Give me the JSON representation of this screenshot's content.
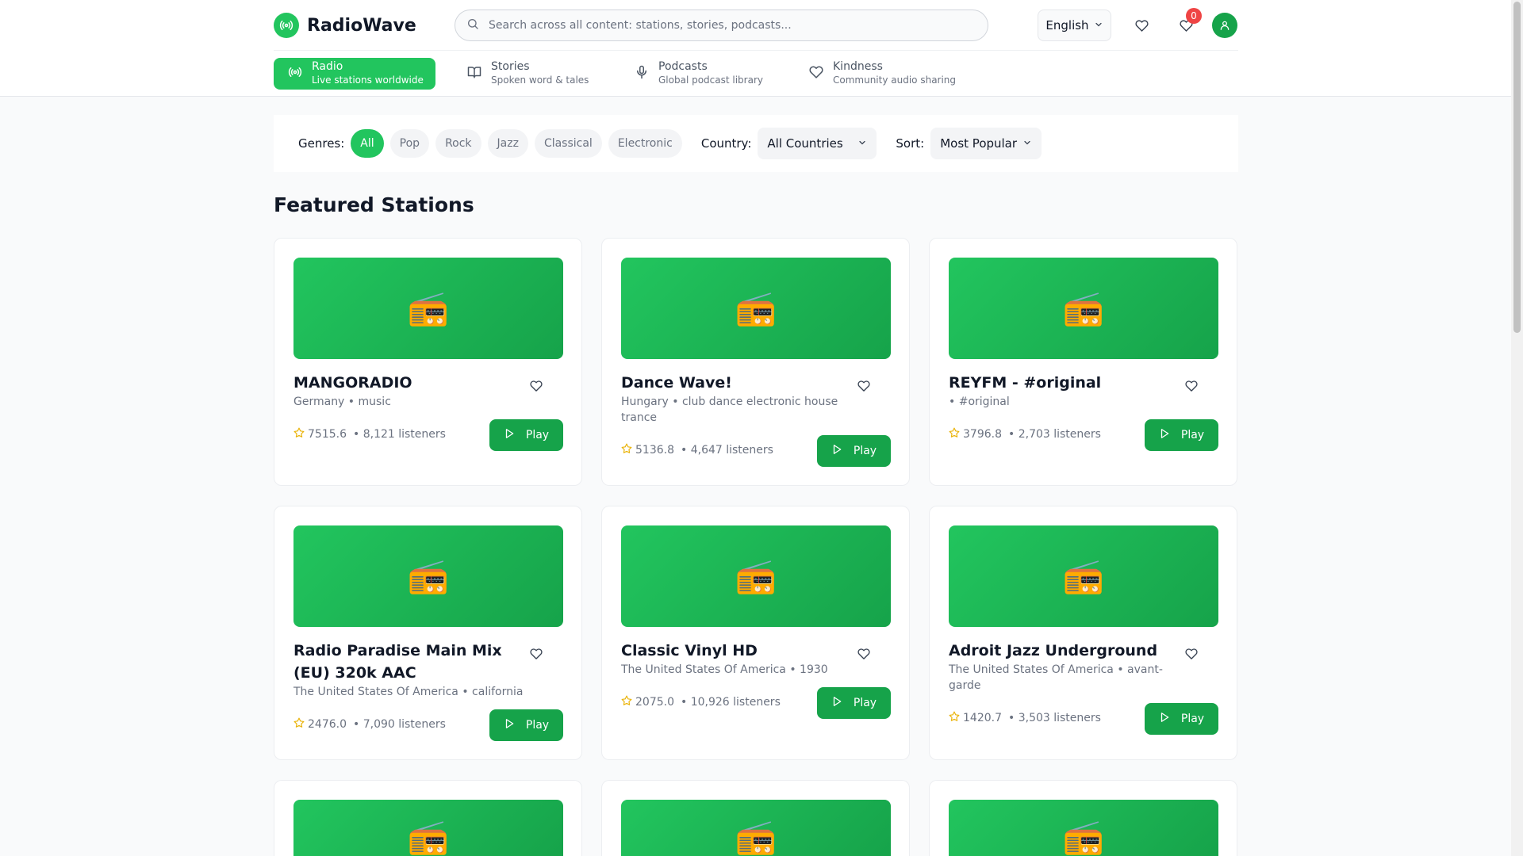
{
  "app": {
    "name": "RadioWave"
  },
  "search": {
    "placeholder": "Search across all content: stations, stories, podcasts..."
  },
  "language": {
    "selected": "English"
  },
  "cart_count": "0",
  "nav": [
    {
      "label": "Radio",
      "sub": "Live stations worldwide",
      "icon": "radio-broadcast-icon"
    },
    {
      "label": "Stories",
      "sub": "Spoken word & tales",
      "icon": "book-icon"
    },
    {
      "label": "Podcasts",
      "sub": "Global podcast library",
      "icon": "microphone-icon"
    },
    {
      "label": "Kindness",
      "sub": "Community audio sharing",
      "icon": "heart-icon"
    }
  ],
  "filters": {
    "genres_label": "Genres:",
    "genres": [
      "All",
      "Pop",
      "Rock",
      "Jazz",
      "Classical",
      "Electronic"
    ],
    "active_genre": "All",
    "country_label": "Country:",
    "country_value": "All Countries",
    "sort_label": "Sort:",
    "sort_value": "Most Popular"
  },
  "section_title": "Featured Stations",
  "play_label": "Play",
  "stations": [
    {
      "name": "MANGORADIO",
      "sub": "Germany • music",
      "score": "7515.6",
      "listeners": "• 8,121 listeners"
    },
    {
      "name": "Dance Wave!",
      "sub": "Hungary • club dance electronic house trance",
      "score": "5136.8",
      "listeners": "• 4,647 listeners"
    },
    {
      "name": "REYFM - #original",
      "sub": "• #original",
      "score": "3796.8",
      "listeners": "• 2,703 listeners"
    },
    {
      "name": "Radio Paradise Main Mix (EU) 320k AAC",
      "sub": "The United States Of America • california",
      "score": "2476.0",
      "listeners": "• 7,090 listeners"
    },
    {
      "name": "Classic Vinyl HD",
      "sub": "The United States Of America • 1930",
      "score": "2075.0",
      "listeners": "• 10,926 listeners"
    },
    {
      "name": "Adroit Jazz Underground",
      "sub": "The United States Of America • avant-garde",
      "score": "1420.7",
      "listeners": "• 3,503 listeners"
    }
  ],
  "colors": {
    "brand": "#22c55e",
    "brand_dark": "#16a34a",
    "badge": "#ef4444",
    "star": "#eab308"
  },
  "icons": {
    "station_image": "📻"
  }
}
